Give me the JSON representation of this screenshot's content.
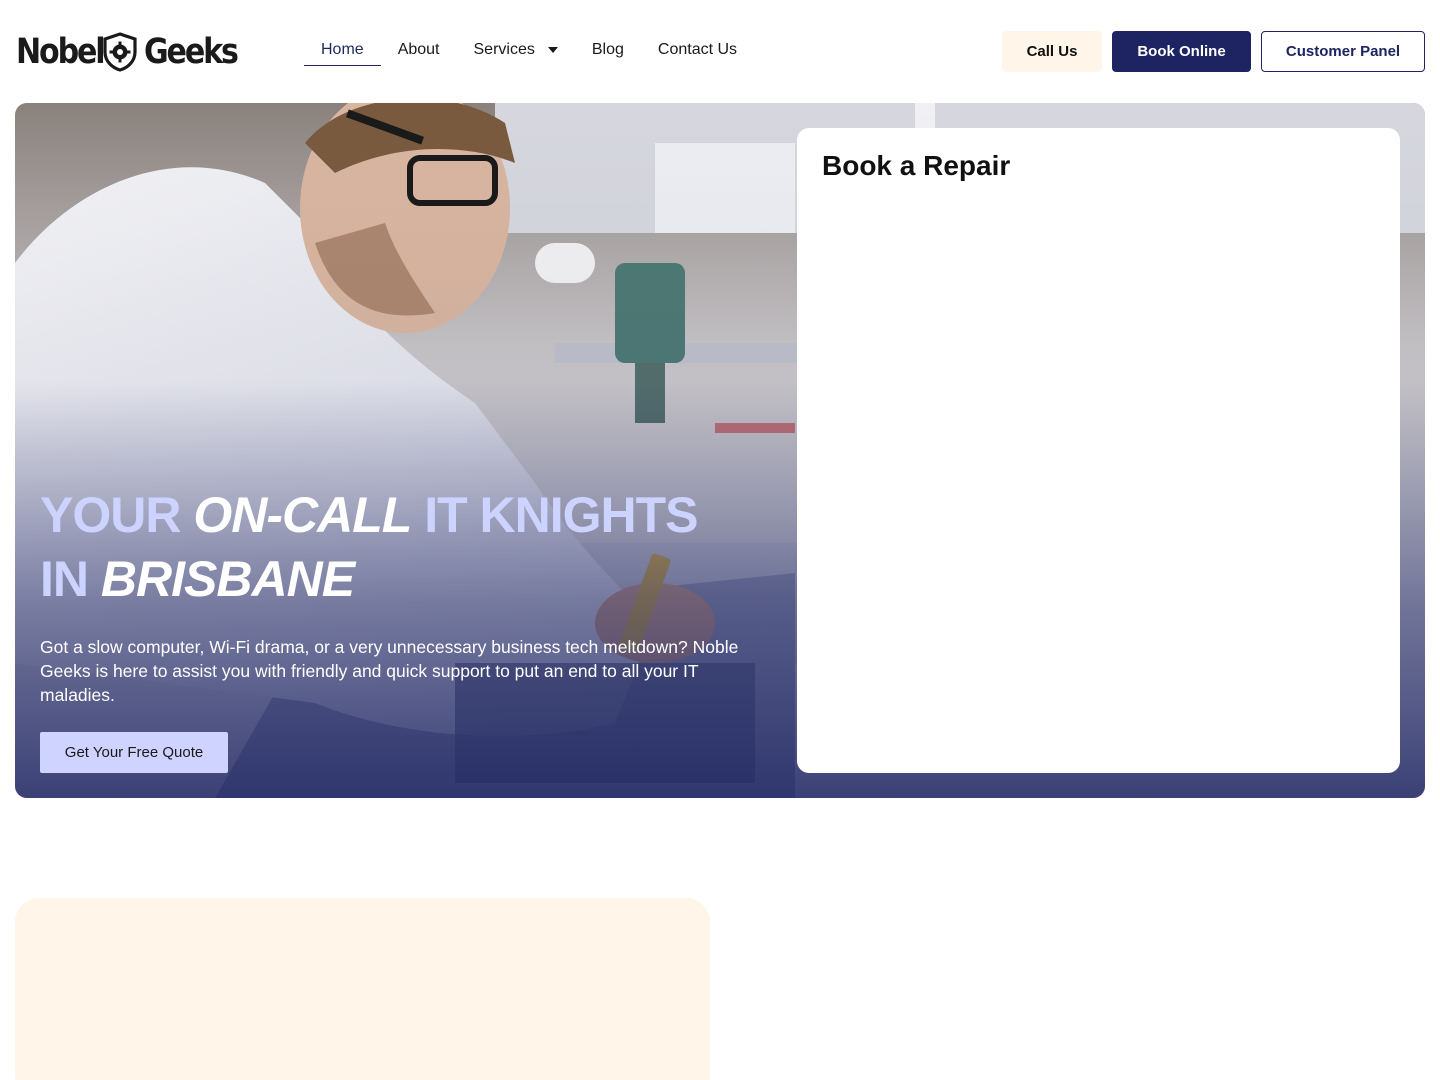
{
  "header": {
    "logo": {
      "word1": "Nobel",
      "word2": "Geeks",
      "icon": "shield-gear-icon"
    },
    "nav": [
      {
        "label": "Home",
        "active": true
      },
      {
        "label": "About"
      },
      {
        "label": "Services",
        "has_dropdown": true
      },
      {
        "label": "Blog"
      },
      {
        "label": "Contact Us"
      }
    ],
    "buttons": {
      "call": "Call Us",
      "book": "Book Online",
      "panel": "Customer Panel"
    }
  },
  "hero": {
    "title_parts": [
      "YOUR ",
      "ON-CALL",
      " IT KNIGHTS",
      "IN ",
      "BRISBANE"
    ],
    "text": "Got a slow computer, Wi-Fi drama, or a very unnecessary business tech meltdown? Noble Geeks is here to assist you with friendly and quick support to put an end to all your IT maladies.",
    "cta": "Get Your Free Quote"
  },
  "repair_card": {
    "title": "Book a Repair"
  },
  "colors": {
    "brand_navy": "#1d2461",
    "cream": "#fff6e9",
    "hero_title_light": "#cdd3ff",
    "cta_bg": "#cfd3ff"
  }
}
